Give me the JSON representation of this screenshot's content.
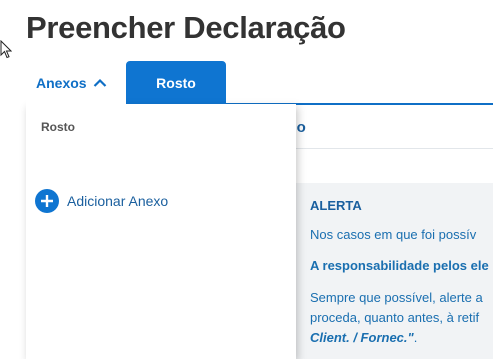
{
  "page": {
    "title": "Preencher Declaração"
  },
  "tabs": [
    {
      "label": "Anexos",
      "expanded": true
    },
    {
      "label": "Rosto",
      "active": true
    }
  ],
  "section": {
    "title": "ício"
  },
  "dropdown": {
    "items": [
      "Rosto"
    ],
    "add_label": "Adicionar Anexo"
  },
  "alert": {
    "title": "ALERTA",
    "line1": "Nos casos em que foi possív",
    "line2": "A responsabilidade pelos ele",
    "line3a": "Sempre que possível, alerte a",
    "line3b": "proceda, quanto antes, à retif",
    "line3c_italic": "Client. / Fornec.\"",
    "line3c_tail": "."
  },
  "colors": {
    "accent": "#0f75d1",
    "text_dark": "#333333",
    "link": "#1a5f9e",
    "alert_bg": "#f1f3f5"
  },
  "icons": [
    "mouse-cursor-icon",
    "chevron-up-icon",
    "plus-icon"
  ]
}
